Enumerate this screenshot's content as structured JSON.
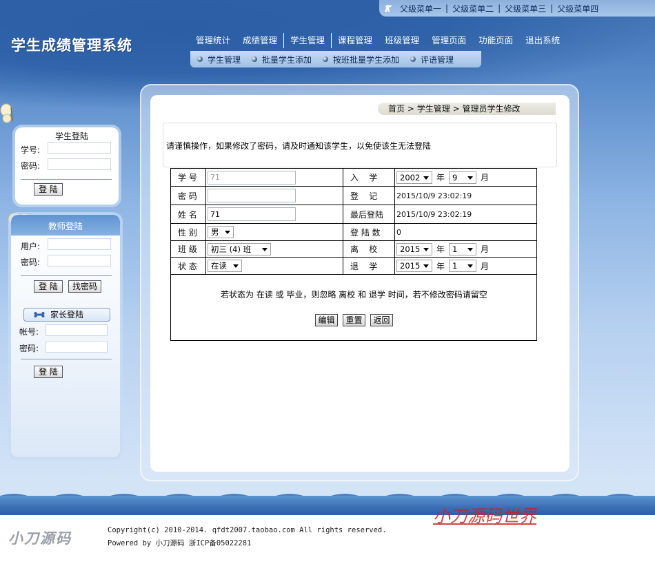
{
  "top_menu": [
    "父级菜单一",
    "父级菜单二",
    "父级菜单三",
    "父级菜单四"
  ],
  "top_menu_separator": "|",
  "site_title": "学生成绩管理系统",
  "nav": [
    "管理统计",
    "成绩管理",
    "学生管理",
    "课程管理",
    "班级管理",
    "管理页面",
    "功能页面",
    "退出系统"
  ],
  "subnav": [
    "学生管理",
    "批量学生添加",
    "按班批量学生添加",
    "评语管理"
  ],
  "student_login": {
    "title": "学生登陆",
    "id_label": "学号:",
    "pwd_label": "密码:",
    "login_button": "登 陆"
  },
  "teacher_login": {
    "title": "教师登陆",
    "user_label": "用户:",
    "pwd_label": "密码:",
    "login_button": "登 陆",
    "find_pwd_button": "找密码"
  },
  "parent_login": {
    "title": "家长登陆",
    "account_label": "帐号:",
    "pwd_label": "密码:",
    "login_button": "登 陆"
  },
  "breadcrumb": {
    "home": "首页",
    "sep": ">",
    "section": "学生管理",
    "current": "管理员学生修改"
  },
  "notice": "请谨慎操作，如果修改了密码，请及时通知该学生，以免使该生无法登陆",
  "form": {
    "student_id_label": "学 号",
    "student_id_value": "71",
    "password_label": "密 码",
    "password_value": "",
    "name_label": "姓 名",
    "name_value": "71",
    "gender_label": "性 别",
    "gender_value": "男",
    "class_label": "班 级",
    "class_value": "初三 (4) 班",
    "status_label": "状 态",
    "status_value": "在读",
    "enroll_label": "入    学",
    "enroll_year": "2002",
    "enroll_month": "9",
    "register_label": "登    记",
    "register_value": "2015/10/9 23:02:19",
    "last_login_label": "最后登陆",
    "last_login_value": "2015/10/9 23:02:19",
    "login_count_label": "登 陆 数",
    "login_count_value": "0",
    "leave_label": "离    校",
    "leave_year": "2015",
    "leave_month": "1",
    "drop_label": "退    学",
    "drop_year": "2015",
    "drop_month": "1",
    "year_unit": "年",
    "month_unit": "月",
    "hint": "若状态为 在读 或 毕业，则忽略 离校 和 退学 时间，若不修改密码请留空",
    "edit_button": "编辑",
    "reset_button": "重置",
    "back_button": "返回"
  },
  "footer": {
    "logo": "小刀源码",
    "copyright": "Copyright(c) 2010-2014. qfdt2007.taobao.com All rights reserved.",
    "powered": "Powered by 小刀源码  浙ICP备05022281"
  },
  "watermark": "小刀源码世界",
  "colors": {
    "header_blue": "#3e6fb2",
    "panel_white": "#ffffff",
    "watermark_red": "#cc2222"
  }
}
